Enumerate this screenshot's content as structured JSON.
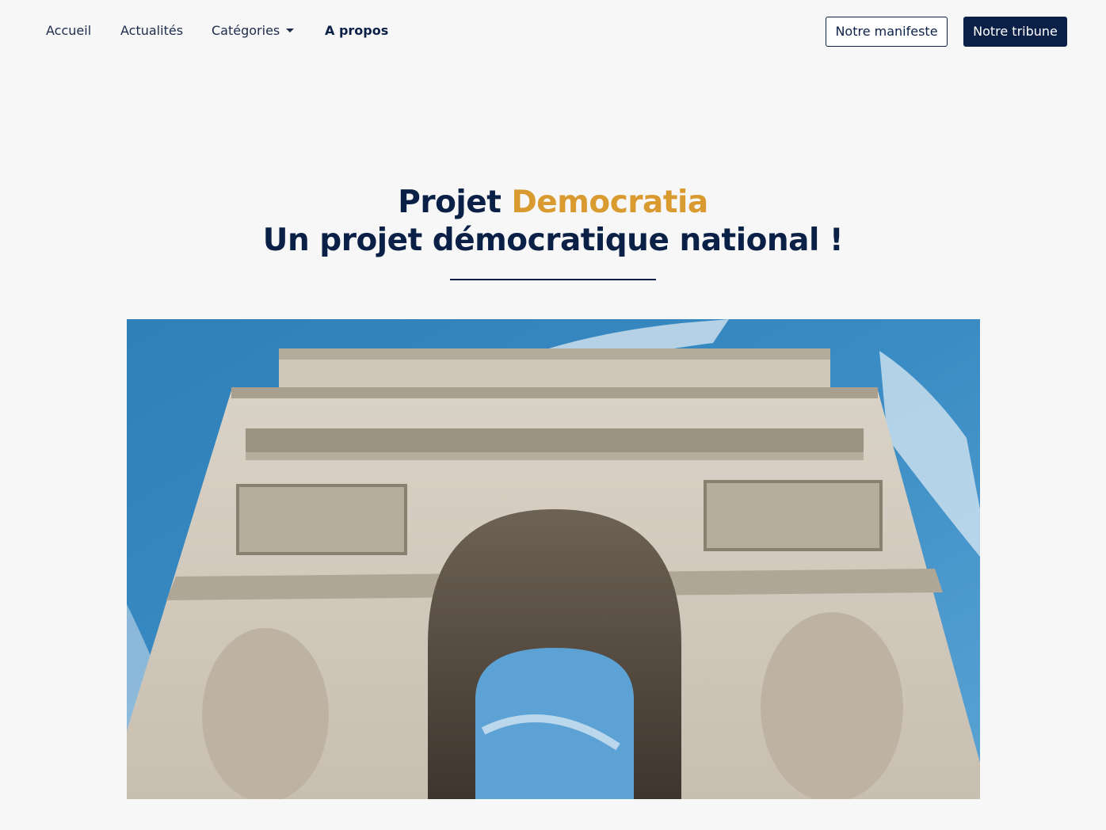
{
  "nav": {
    "links": [
      {
        "label": "Accueil"
      },
      {
        "label": "Actualités"
      },
      {
        "label": "Catégories"
      },
      {
        "label": "A propos"
      }
    ],
    "buttons": {
      "manifesto_label": "Notre manifeste",
      "tribune_label": "Notre tribune"
    }
  },
  "hero": {
    "title_line1_part1": "Projet ",
    "title_line1_accent": "Democratia",
    "title_line2": "Un projet démocratique national !",
    "image_icon": "arc-de-triomphe-photo"
  },
  "colors": {
    "brand_navy": "#0b2047",
    "accent_gold": "#d99a2f",
    "background": "#f7f7f7"
  }
}
